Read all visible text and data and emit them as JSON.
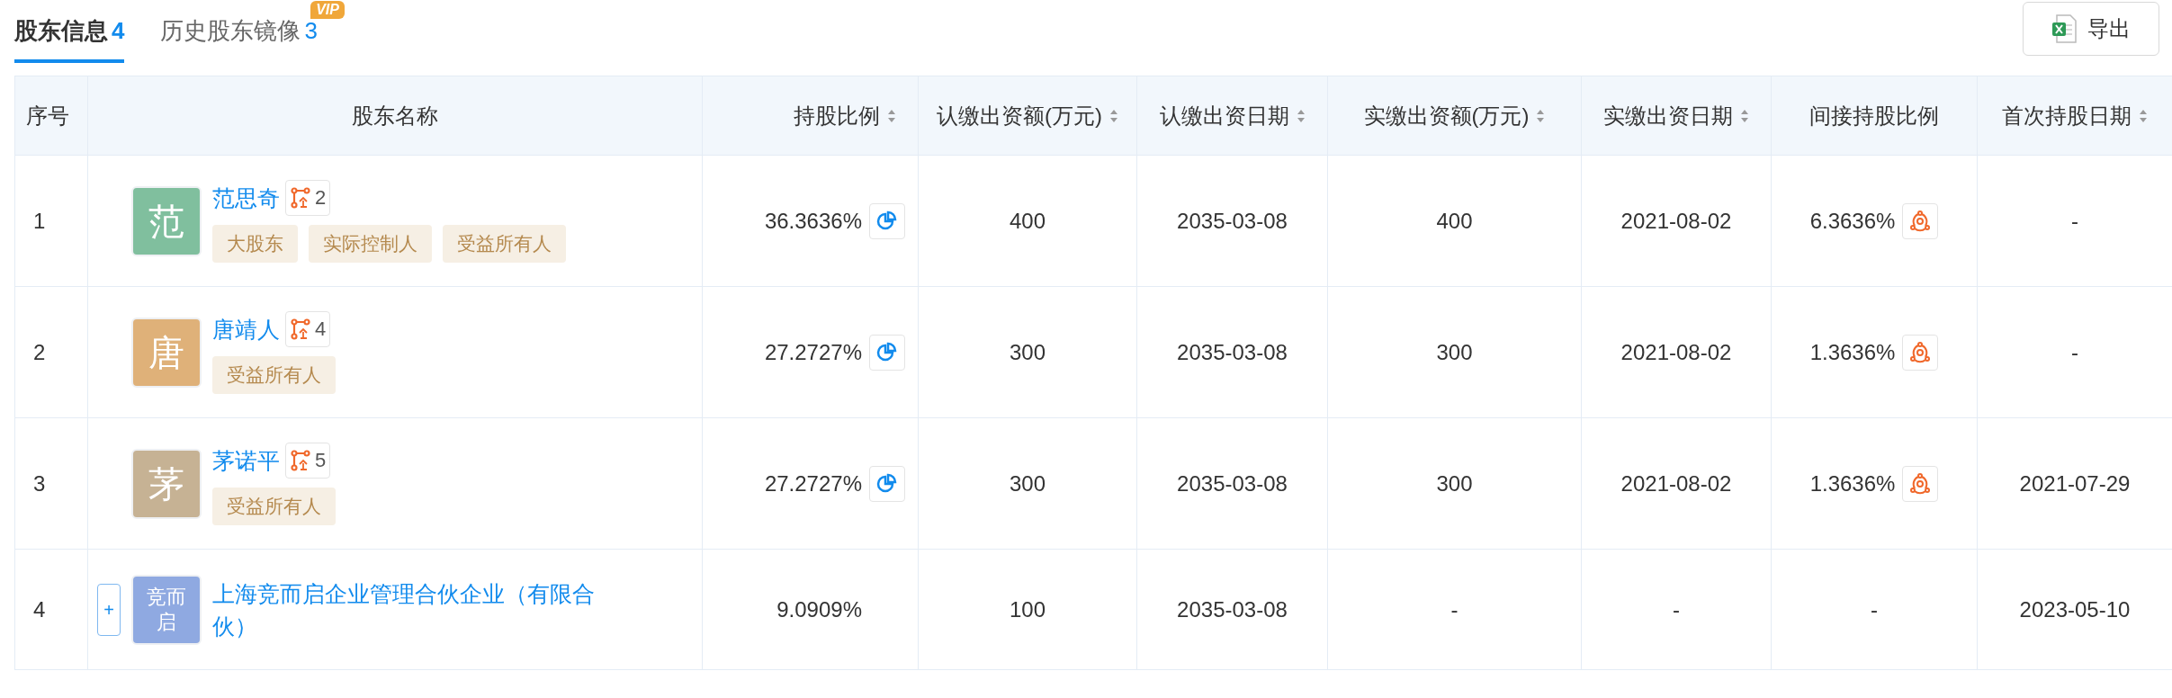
{
  "tabs": [
    {
      "label": "股东信息",
      "count": "4",
      "selected": true
    },
    {
      "label": "历史股东镜像",
      "count": "3",
      "selected": false,
      "badge": "VIP"
    }
  ],
  "export_button": {
    "label": "导出"
  },
  "table": {
    "columns": [
      {
        "label": "序号",
        "sortable": false
      },
      {
        "label": "股东名称",
        "sortable": false
      },
      {
        "label": "持股比例",
        "sortable": true
      },
      {
        "label": "认缴出资额(万元)",
        "sortable": true
      },
      {
        "label": "认缴出资日期",
        "sortable": true
      },
      {
        "label": "实缴出资额(万元)",
        "sortable": true
      },
      {
        "label": "实缴出资日期",
        "sortable": true
      },
      {
        "label": "间接持股比例",
        "sortable": false
      },
      {
        "label": "首次持股日期",
        "sortable": true
      }
    ],
    "rows": [
      {
        "index": "1",
        "expandable": false,
        "avatar": {
          "text": "范",
          "color": "#80bf9e"
        },
        "name": "范思奇",
        "related_count": "2",
        "tags": [
          "大股东",
          "实际控制人",
          "受益所有人"
        ],
        "ratio": "36.3636%",
        "chart_button": true,
        "subscribed_amount": "400",
        "subscribed_date": "2035-03-08",
        "paid_amount": "400",
        "paid_date": "2021-08-02",
        "indirect_ratio": "6.3636%",
        "indirect_button": true,
        "first_date": "-"
      },
      {
        "index": "2",
        "expandable": false,
        "avatar": {
          "text": "唐",
          "color": "#dfb179"
        },
        "name": "唐靖人",
        "related_count": "4",
        "tags": [
          "受益所有人"
        ],
        "ratio": "27.2727%",
        "chart_button": true,
        "subscribed_amount": "300",
        "subscribed_date": "2035-03-08",
        "paid_amount": "300",
        "paid_date": "2021-08-02",
        "indirect_ratio": "1.3636%",
        "indirect_button": true,
        "first_date": "-"
      },
      {
        "index": "3",
        "expandable": false,
        "avatar": {
          "text": "茅",
          "color": "#c6b294"
        },
        "name": "茅诺平",
        "related_count": "5",
        "tags": [
          "受益所有人"
        ],
        "ratio": "27.2727%",
        "chart_button": true,
        "subscribed_amount": "300",
        "subscribed_date": "2035-03-08",
        "paid_amount": "300",
        "paid_date": "2021-08-02",
        "indirect_ratio": "1.3636%",
        "indirect_button": true,
        "first_date": "2021-07-29"
      },
      {
        "index": "4",
        "expandable": true,
        "expand_symbol": "+",
        "avatar": {
          "text": "竞而启",
          "color": "#8fa9e1"
        },
        "name": "上海竞而启企业管理合伙企业（有限合伙）",
        "tags": [],
        "ratio": "9.0909%",
        "chart_button": false,
        "subscribed_amount": "100",
        "subscribed_date": "2035-03-08",
        "paid_amount": "-",
        "paid_date": "-",
        "indirect_ratio": "-",
        "indirect_button": false,
        "first_date": "2023-05-10"
      }
    ]
  }
}
